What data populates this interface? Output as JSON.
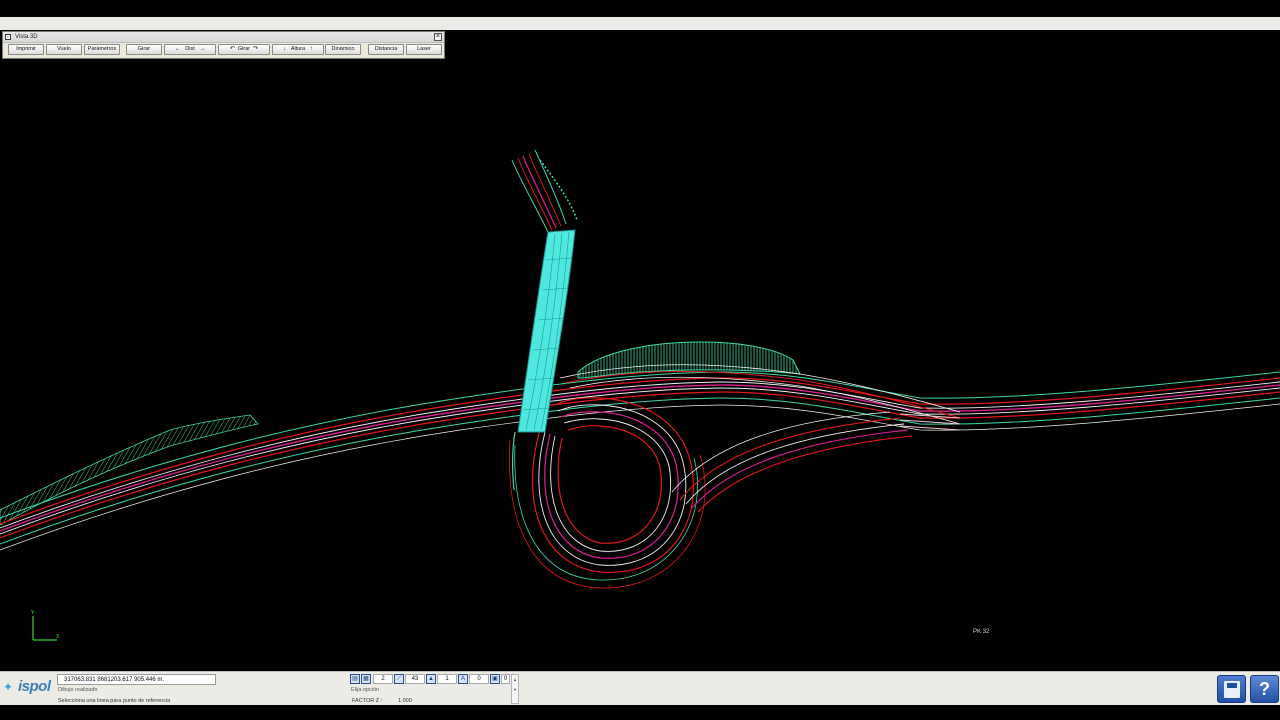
{
  "vista": {
    "title": "Vista 3D",
    "close": "×",
    "buttons": {
      "imprimir": "Imprimir",
      "vuelo": "Vuelo",
      "parametros": "Parámetros",
      "girar1": "Girar",
      "dist_left": "←",
      "dist": "Dist",
      "dist_right": "→",
      "girar2_left": "↶",
      "girar2": "Girar",
      "girar2_right": "↷",
      "altura_down": "↓",
      "altura": "Altura",
      "altura_up": "↑",
      "dinamico": "Dinámico",
      "distancia": "Distancia",
      "laser": "Laser"
    }
  },
  "canvas": {
    "axis_y": "Y",
    "axis_x": "X",
    "pk_label": "PK 32"
  },
  "colors": {
    "road_edge": "#e01818",
    "road_center": "#d0208a",
    "road_line": "#f2f2f2",
    "slope": "#3cd8a8",
    "bridge": "#4fe8e0"
  },
  "status": {
    "coordinates": "317063.831   8681203.617   905.446     m.",
    "message1": "Dibujo realizado",
    "message2": "Selecciona una linea para punto de referencia",
    "elija": "Elija opción",
    "factor_label": "FACTOR Z :",
    "factor_value": "1.000",
    "values": [
      "2",
      "43",
      "1",
      "0",
      "0"
    ]
  },
  "logo": {
    "name": "ispol"
  },
  "help": {
    "label": "?"
  }
}
